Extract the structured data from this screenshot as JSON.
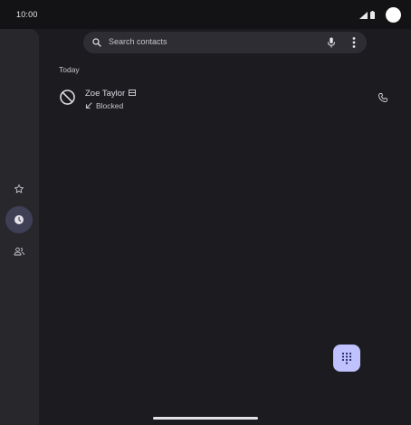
{
  "status_bar": {
    "time": "10:00"
  },
  "search": {
    "placeholder": "Search contacts"
  },
  "recents": {
    "section_title": "Today",
    "calls": [
      {
        "name": "Zoe Taylor",
        "status": "Blocked",
        "icon": "blocked-icon",
        "direction_icon": "incoming-call-arrow-icon"
      }
    ]
  },
  "navigation_rail": {
    "items": [
      {
        "icon": "star-icon",
        "active": false
      },
      {
        "icon": "clock-icon",
        "active": true
      },
      {
        "icon": "people-icon",
        "active": false
      }
    ]
  },
  "fab": {
    "icon": "dialpad-icon"
  },
  "colors": {
    "background": "#1b1b1f",
    "rail": "#28282c",
    "search_bar": "#2d2d33",
    "active_indicator": "#3f3f56",
    "fab": "#c0c1ff"
  }
}
